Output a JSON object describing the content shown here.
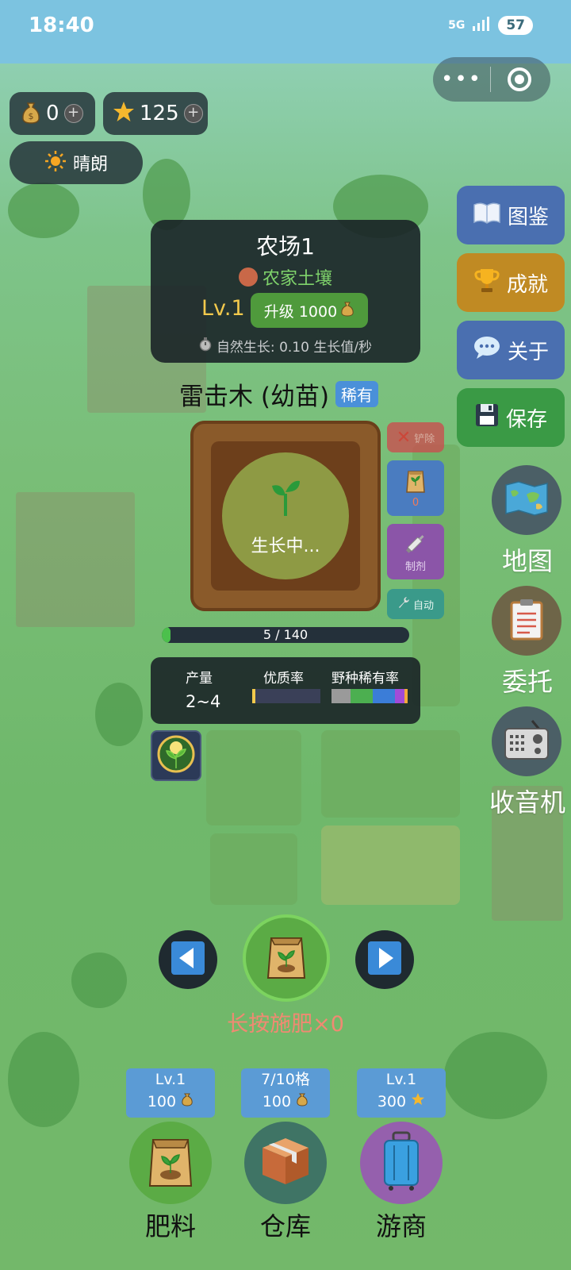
{
  "status_bar": {
    "time": "18:40",
    "network": "5G",
    "battery": "57"
  },
  "resources": {
    "coins": "0",
    "stars": "125",
    "weather": "晴朗"
  },
  "side_menu": [
    {
      "label": "图鉴",
      "color": "#4a6fb0"
    },
    {
      "label": "成就",
      "color": "#c08a23"
    },
    {
      "label": "关于",
      "color": "#4a6fb0"
    },
    {
      "label": "保存",
      "color": "#3a9a45"
    }
  ],
  "round_menu": [
    {
      "label": "地图"
    },
    {
      "label": "委托"
    },
    {
      "label": "收音机"
    }
  ],
  "farm": {
    "name": "农场1",
    "soil": "农家土壤",
    "level": "Lv.1",
    "upgrade_label": "升级 1000",
    "growth_rate": "自然生长: 0.10 生长值/秒"
  },
  "plant": {
    "name": "雷击木 (幼苗)",
    "rarity": "稀有",
    "status": "生长中...",
    "progress_text": "5 / 140",
    "progress_fraction": 0.036
  },
  "plot_actions": {
    "remove": "铲除",
    "fertilizer_count": "0",
    "potion": "制剂",
    "auto": "自动"
  },
  "stats": {
    "yield_label": "产量",
    "yield_value": "2~4",
    "quality_label": "优质率",
    "wild_label": "野种稀有率"
  },
  "fertilize_hint": "长按施肥×0",
  "bottom": [
    {
      "line1": "Lv.1",
      "line2": "100",
      "currency": "coin",
      "label": "肥料",
      "circle": "#5bab45"
    },
    {
      "line1": "7/10格",
      "line2": "100",
      "currency": "coin",
      "label": "仓库",
      "circle": "#3f7465"
    },
    {
      "line1": "Lv.1",
      "line2": "300",
      "currency": "star",
      "label": "游商",
      "circle": "#9560ad"
    }
  ],
  "colors": {
    "accent_gold": "#f2c94c",
    "green_btn": "#4f9a3c",
    "blue_btn": "#5b9bd5"
  }
}
